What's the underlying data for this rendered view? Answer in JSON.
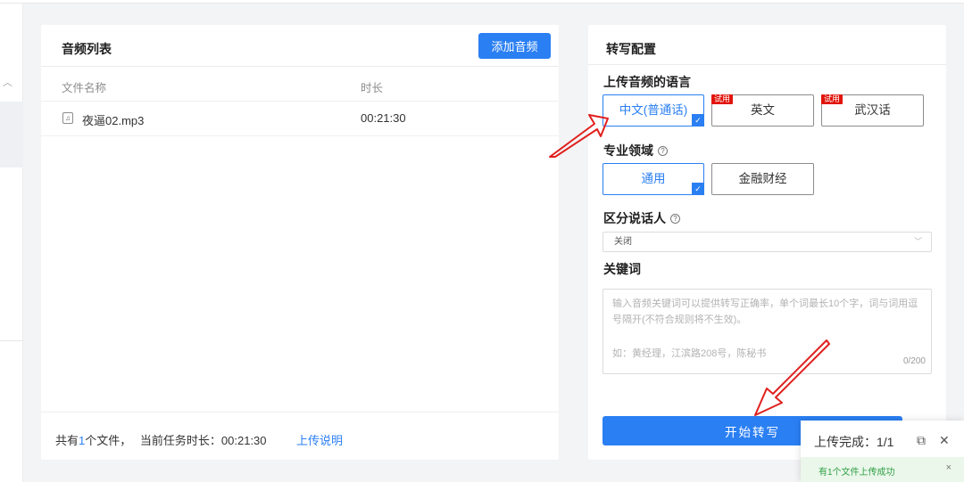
{
  "audio_panel": {
    "title": "音频列表",
    "add_button": "添加音频",
    "columns": [
      "文件名称",
      "时长"
    ],
    "rows": [
      {
        "icon": "music-file-icon",
        "name": "夜逼02.mp3",
        "duration": "00:21:30"
      }
    ],
    "footer": {
      "prefix": "共有",
      "count": "1",
      "suffix": "个文件，",
      "duration_label": "当前任务时长：",
      "duration_value": "00:21:30",
      "help_link": "上传说明"
    }
  },
  "config_panel": {
    "title": "转写配置",
    "language": {
      "label": "上传音频的语言",
      "options": [
        {
          "label": "中文(普通话)",
          "selected": true,
          "badge": ""
        },
        {
          "label": "英文",
          "selected": false,
          "badge": "试用"
        },
        {
          "label": "武汉话",
          "selected": false,
          "badge": "试用"
        }
      ]
    },
    "domain": {
      "label": "专业领域",
      "options": [
        {
          "label": "通用",
          "selected": true
        },
        {
          "label": "金融财经",
          "selected": false
        }
      ]
    },
    "speaker": {
      "label": "区分说话人",
      "value": "关闭"
    },
    "keywords": {
      "label": "关键词",
      "placeholder_line1": "输入音频关键词可以提供转写正确率，单个词最长10个字，词与词用逗号隔开(不符合规则将不生效)。",
      "placeholder_line2": "如：黄经理，江滨路208号，陈秘书",
      "counter": "0/200"
    },
    "start_button": "开始转写"
  },
  "toast": {
    "title": "上传完成：1/1",
    "message": "有1个文件上传成功"
  },
  "colors": {
    "accent": "#2a7ff3",
    "trial_badge": "#e1140a",
    "annotation_arrow": "#e0201e",
    "success_bg": "#eaf7ea",
    "success_text": "#2f9e44"
  }
}
